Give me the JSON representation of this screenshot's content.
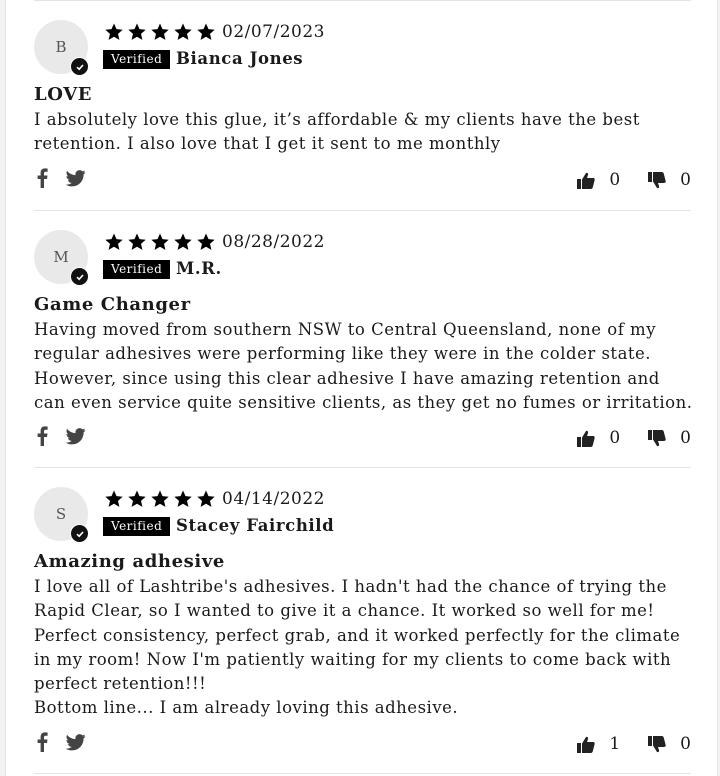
{
  "colors": {
    "star": "#000000",
    "badge_bg": "#000000",
    "divider": "#e4e4e4",
    "avatar_bg": "#e9e9e9"
  },
  "reviews": [
    {
      "initial": "B",
      "rating": 5,
      "date": "02/07/2023",
      "verified": "Verified",
      "name": "Bianca Jones",
      "title": "LOVE",
      "body": [
        "I absolutely love this glue, it’s affordable & my clients have the best retention. I also love that I get it sent to me monthly"
      ],
      "up": "0",
      "down": "0"
    },
    {
      "initial": "M",
      "rating": 5,
      "date": "08/28/2022",
      "verified": "Verified",
      "name": "M.R.",
      "title": "Game Changer",
      "body": [
        "Having moved from southern NSW to Central Queensland, none of my regular adhesives were performing like they were in the colder state. However, since using this clear adhesive I have amazing retention and can even service quite sensitive clients, as they get no fumes or irritation."
      ],
      "up": "0",
      "down": "0"
    },
    {
      "initial": "S",
      "rating": 5,
      "date": "04/14/2022",
      "verified": "Verified",
      "name": "Stacey Fairchild",
      "title": "Amazing adhesive",
      "body": [
        "I love all of Lashtribe's adhesives. I hadn't had the chance of trying the Rapid Clear, so I wanted to give it a chance. It worked so well for me! Perfect consistency, perfect grab, and it worked perfectly for the climate in my room! Now I'm patiently waiting for my clients to come back with perfect retention!!!",
        "Bottom line... I am already loving this adhesive."
      ],
      "up": "1",
      "down": "0"
    }
  ]
}
